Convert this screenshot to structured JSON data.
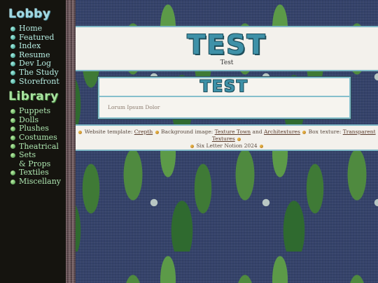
{
  "sidebar": {
    "lobby_title": "Lobby",
    "lobby_items": [
      {
        "label": "Home"
      },
      {
        "label": "Featured"
      },
      {
        "label": "Index"
      },
      {
        "label": "Resume"
      },
      {
        "label": "Dev Log"
      },
      {
        "label": "The Study"
      },
      {
        "label": "Storefront"
      }
    ],
    "library_title": "Library",
    "library_items": [
      {
        "label": "Puppets"
      },
      {
        "label": "Dolls"
      },
      {
        "label": "Plushes"
      },
      {
        "label": "Costumes"
      },
      {
        "label": "Theatrical"
      },
      {
        "label": "Sets"
      },
      {
        "label": "& Props"
      },
      {
        "label": "Textiles"
      },
      {
        "label": "Miscellany"
      }
    ]
  },
  "header": {
    "title": "TEST",
    "subtitle": "Test"
  },
  "content": {
    "box_title": "TEST",
    "body_text": "Lorum Ipsum Dolor"
  },
  "footer": {
    "template_label": "Website template:",
    "template_link": "Crepth",
    "background_label": "Background image:",
    "background_link_1": "Texture Town",
    "and_text": "and",
    "background_link_2": "Architextures",
    "box_label": "Box texture:",
    "box_link": "Transparent Textures",
    "copyright": "Six Letter Notion 2024"
  },
  "colors": {
    "accent": "#3e91a8",
    "sidebar_bg": "#15140f",
    "lobby_text": "#b6ede2",
    "library_text": "#aee6b0"
  },
  "icons": {
    "nav_bullet": "orb-bullet-icon",
    "footer_bullet": "gold-dot-icon"
  }
}
